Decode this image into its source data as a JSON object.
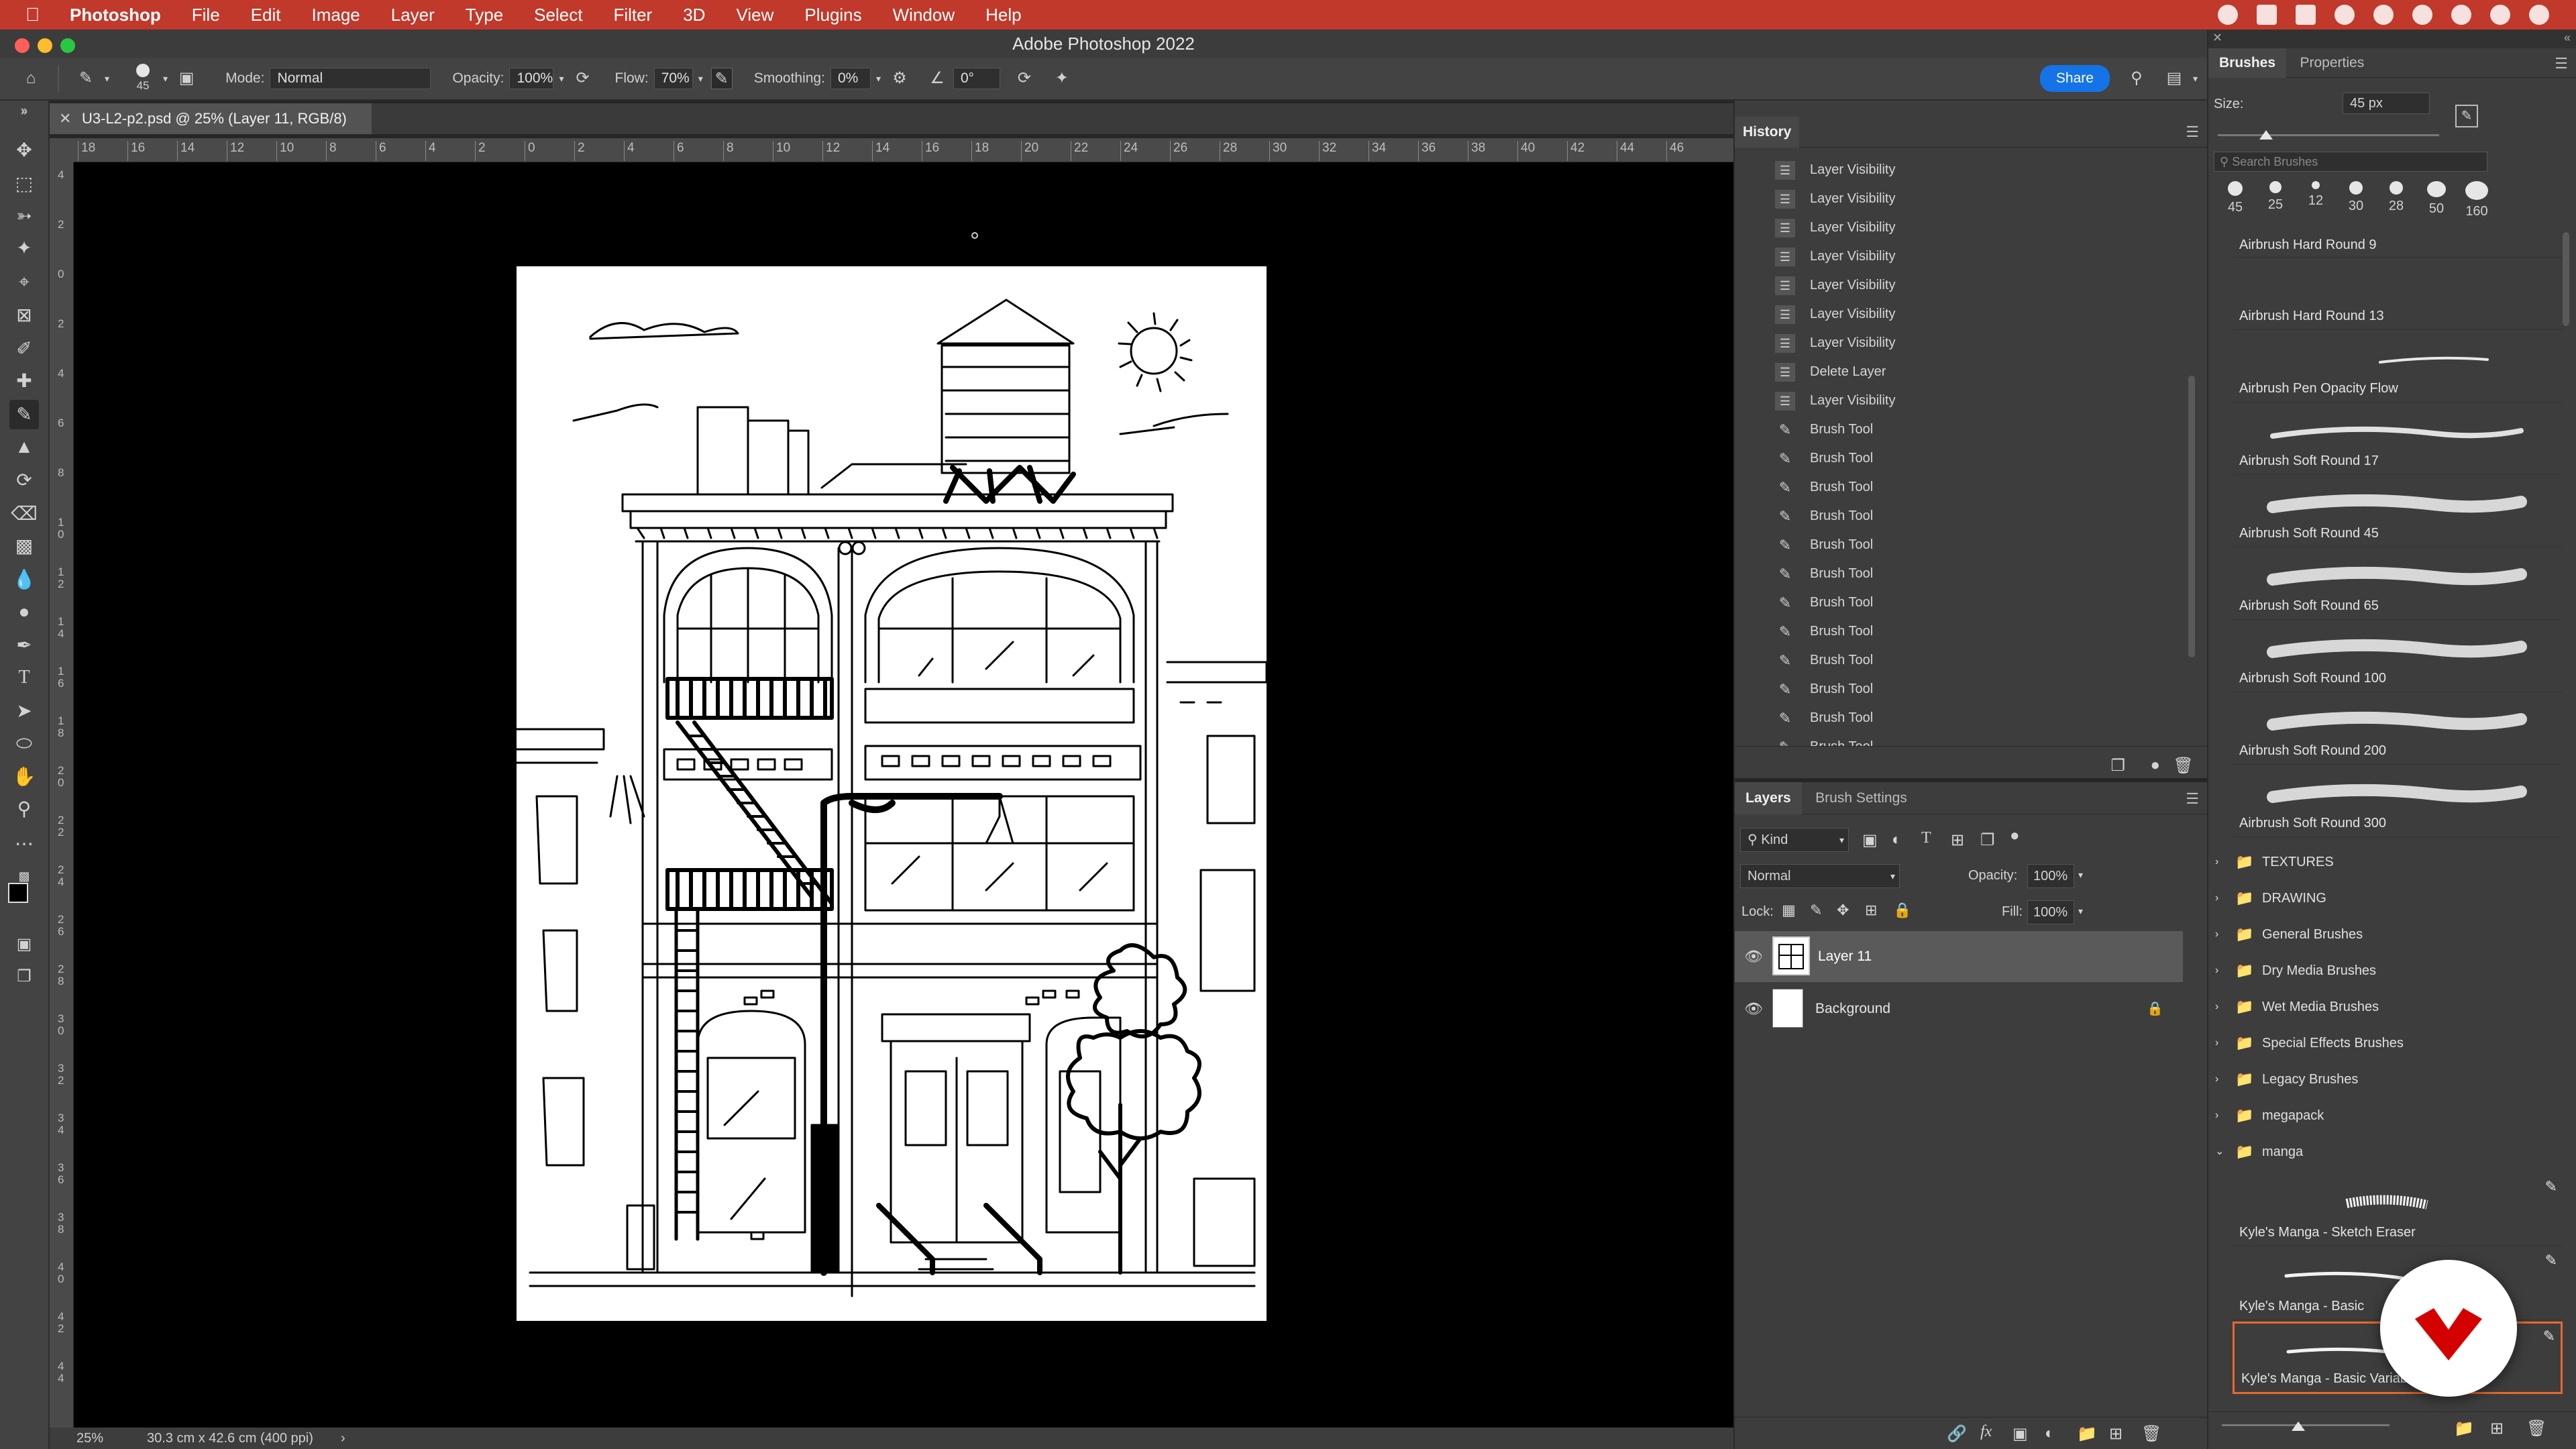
{
  "menubar": {
    "app": "Photoshop",
    "items": [
      "File",
      "Edit",
      "Image",
      "Layer",
      "Type",
      "Select",
      "Filter",
      "3D",
      "View",
      "Plugins",
      "Window",
      "Help"
    ]
  },
  "titlebar": {
    "title": "Adobe Photoshop 2022"
  },
  "options": {
    "brush_size": "45",
    "mode_label": "Mode:",
    "mode_value": "Normal",
    "opacity_label": "Opacity:",
    "opacity_value": "100%",
    "flow_label": "Flow:",
    "flow_value": "70%",
    "smoothing_label": "Smoothing:",
    "smoothing_value": "0%",
    "angle_value": "0°",
    "share_label": "Share"
  },
  "document": {
    "tab_title": "U3-L2-p2.psd @ 25% (Layer 11, RGB/8)",
    "zoom": "25%",
    "doc_size": "30.3 cm x 42.6 cm (400 ppi)"
  },
  "rulers": {
    "h_ticks": [
      "18",
      "16",
      "14",
      "12",
      "10",
      "8",
      "6",
      "4",
      "2",
      "0",
      "2",
      "4",
      "6",
      "8",
      "10",
      "12",
      "14",
      "16",
      "18",
      "20",
      "22",
      "24",
      "26",
      "28",
      "30",
      "32",
      "34",
      "36",
      "38",
      "40",
      "42",
      "44",
      "46"
    ],
    "v_ticks": [
      "4",
      "2",
      "0",
      "2",
      "4",
      "6",
      "8",
      "1 0",
      "1 2",
      "1 4",
      "1 6",
      "1 8",
      "2 0",
      "2 2",
      "2 4",
      "2 6",
      "2 8",
      "3 0",
      "3 2",
      "3 4",
      "3 6",
      "3 8",
      "4 0",
      "4 2",
      "4 4"
    ]
  },
  "history": {
    "title": "History",
    "items": [
      {
        "icon": "doc",
        "label": "Layer Visibility"
      },
      {
        "icon": "doc",
        "label": "Layer Visibility"
      },
      {
        "icon": "doc",
        "label": "Layer Visibility"
      },
      {
        "icon": "doc",
        "label": "Layer Visibility"
      },
      {
        "icon": "doc",
        "label": "Layer Visibility"
      },
      {
        "icon": "doc",
        "label": "Layer Visibility"
      },
      {
        "icon": "doc",
        "label": "Layer Visibility"
      },
      {
        "icon": "doc",
        "label": "Delete Layer"
      },
      {
        "icon": "doc",
        "label": "Layer Visibility"
      },
      {
        "icon": "brush",
        "label": "Brush Tool"
      },
      {
        "icon": "brush",
        "label": "Brush Tool"
      },
      {
        "icon": "brush",
        "label": "Brush Tool"
      },
      {
        "icon": "brush",
        "label": "Brush Tool"
      },
      {
        "icon": "brush",
        "label": "Brush Tool"
      },
      {
        "icon": "brush",
        "label": "Brush Tool"
      },
      {
        "icon": "brush",
        "label": "Brush Tool"
      },
      {
        "icon": "brush",
        "label": "Brush Tool"
      },
      {
        "icon": "brush",
        "label": "Brush Tool"
      },
      {
        "icon": "brush",
        "label": "Brush Tool"
      },
      {
        "icon": "brush",
        "label": "Brush Tool"
      },
      {
        "icon": "brush",
        "label": "Brush Tool"
      }
    ]
  },
  "layers_panel": {
    "tab_layers": "Layers",
    "tab_brush_settings": "Brush Settings",
    "kind_label": "Kind",
    "blend_mode": "Normal",
    "opacity_label": "Opacity:",
    "opacity_value": "100%",
    "lock_label": "Lock:",
    "fill_label": "Fill:",
    "fill_value": "100%",
    "layers": [
      {
        "name": "Layer 11",
        "visible": true,
        "selected": true
      },
      {
        "name": "Background",
        "visible": true,
        "locked": true
      }
    ]
  },
  "brushes_panel": {
    "tab_brushes": "Brushes",
    "tab_properties": "Properties",
    "size_label": "Size:",
    "size_value": "45 px",
    "search_placeholder": "Search Brushes",
    "recent_sizes": [
      "45",
      "25",
      "12",
      "30",
      "28",
      "50",
      "160"
    ],
    "brushes": [
      "Airbrush Hard Round 9",
      "Airbrush Hard Round 13",
      "Airbrush Pen Opacity Flow",
      "Airbrush Soft Round 17",
      "Airbrush Soft Round 45",
      "Airbrush Soft Round 65",
      "Airbrush Soft Round 100",
      "Airbrush Soft Round 200",
      "Airbrush Soft Round 300"
    ],
    "folders": [
      "TEXTURES",
      "DRAWING",
      "General Brushes",
      "Dry Media Brushes",
      "Wet Media Brushes",
      "Special Effects Brushes",
      "Legacy Brushes",
      "megapack",
      "manga"
    ],
    "manga_brushes": [
      "Kyle's Manga - Sketch Eraser",
      "Kyle's Manga - Basic",
      "Kyle's Manga - Basic Variable"
    ]
  },
  "colors": {
    "menubar": "#c0392b",
    "accent": "#1473e6",
    "selection": "#e8672f",
    "logo": "#d40000"
  }
}
